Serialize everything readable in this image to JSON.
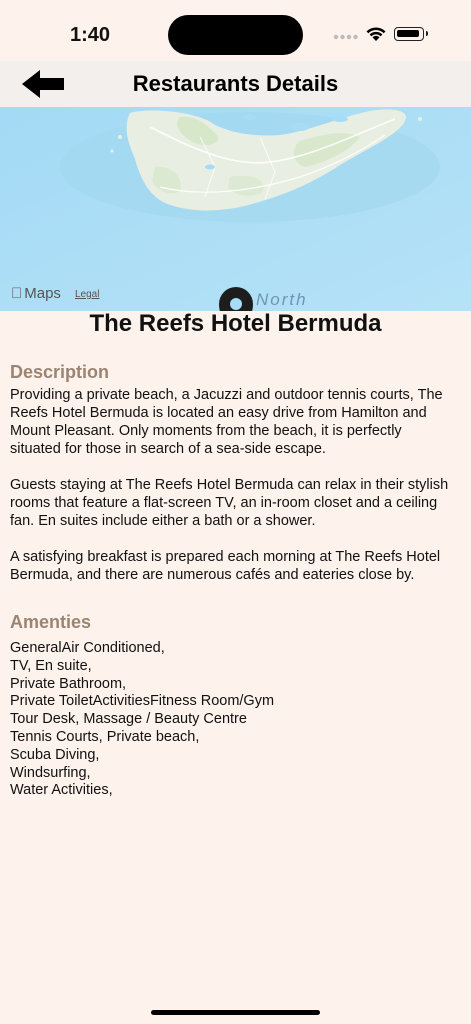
{
  "status_bar": {
    "time": "1:40"
  },
  "nav": {
    "title": "Restaurants Details",
    "back_icon": "arrow-left-icon"
  },
  "map": {
    "provider_label": "Maps",
    "legal_label": "Legal",
    "direction_label": "North",
    "pin_icon": "map-pin-icon"
  },
  "hotel": {
    "name": "The Reefs Hotel Bermuda"
  },
  "description": {
    "heading": "Description",
    "paragraphs": [
      "Providing a private beach, a Jacuzzi and outdoor tennis courts, The Reefs Hotel Bermuda is located an easy drive from Hamilton and Mount Pleasant. Only moments from the beach, it is perfectly situated for those in search of a sea-side escape.",
      "Guests staying at The Reefs Hotel Bermuda can relax in their stylish rooms that feature a flat-screen TV, an in-room closet and a ceiling fan. En suites include either a bath or a shower.",
      "A satisfying breakfast is prepared each morning at The Reefs Hotel Bermuda, and there are numerous cafés and eateries close by."
    ]
  },
  "amenities": {
    "heading": "Amenties",
    "lines": [
      "GeneralAir Conditioned,",
      "TV, En suite,",
      "Private Bathroom,",
      "Private ToiletActivitiesFitness Room/Gym",
      "Tour Desk, Massage / Beauty Centre",
      "Tennis Courts, Private beach,",
      "Scuba Diving,",
      "Windsurfing,",
      "Water Activities,"
    ]
  },
  "colors": {
    "background": "#fdf2ec",
    "nav_background": "#f2efec",
    "section_heading": "#9b8472",
    "map_water": "#a6dcf6"
  }
}
